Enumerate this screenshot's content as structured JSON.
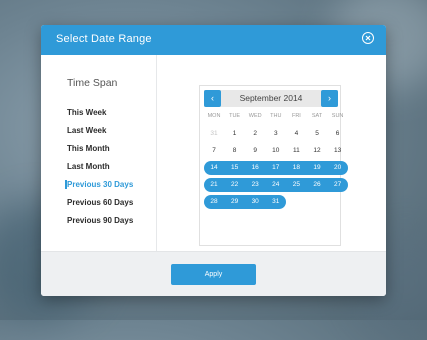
{
  "dialog": {
    "title": "Select Date Range",
    "close_icon": "close-circle-icon",
    "accent_color": "#2f9ad8"
  },
  "timespan": {
    "heading": "Time Span",
    "items": [
      {
        "label": "This Week",
        "active": false
      },
      {
        "label": "Last Week",
        "active": false
      },
      {
        "label": "This Month",
        "active": false
      },
      {
        "label": "Last Month",
        "active": false
      },
      {
        "label": "Previous 30 Days",
        "active": true
      },
      {
        "label": "Previous 60 Days",
        "active": false
      },
      {
        "label": "Previous 90 Days",
        "active": false
      }
    ]
  },
  "calendar": {
    "month_label": "September 2014",
    "prev_icon": "chevron-left-icon",
    "prev_glyph": "‹",
    "next_icon": "chevron-right-icon",
    "next_glyph": "›",
    "weekdays": [
      "MON",
      "TUE",
      "WED",
      "THU",
      "FRI",
      "SAT",
      "SUN"
    ],
    "weeks": [
      [
        {
          "d": "31",
          "muted": true
        },
        {
          "d": "1"
        },
        {
          "d": "2"
        },
        {
          "d": "3"
        },
        {
          "d": "4"
        },
        {
          "d": "5"
        },
        {
          "d": "6"
        }
      ],
      [
        {
          "d": "7"
        },
        {
          "d": "8"
        },
        {
          "d": "9"
        },
        {
          "d": "10"
        },
        {
          "d": "11"
        },
        {
          "d": "12"
        },
        {
          "d": "13"
        }
      ],
      [
        {
          "d": "14",
          "sel": true
        },
        {
          "d": "15",
          "sel": true
        },
        {
          "d": "16",
          "sel": true
        },
        {
          "d": "17",
          "sel": true
        },
        {
          "d": "18",
          "sel": true
        },
        {
          "d": "19",
          "sel": true
        },
        {
          "d": "20",
          "sel": true
        }
      ],
      [
        {
          "d": "21",
          "sel": true
        },
        {
          "d": "22",
          "sel": true
        },
        {
          "d": "23",
          "sel": true
        },
        {
          "d": "24",
          "sel": true
        },
        {
          "d": "25",
          "sel": true
        },
        {
          "d": "26",
          "sel": true
        },
        {
          "d": "27",
          "sel": true
        }
      ],
      [
        {
          "d": "28",
          "sel": true
        },
        {
          "d": "29",
          "sel": true
        },
        {
          "d": "30",
          "sel": true
        },
        {
          "d": "31",
          "sel": true
        }
      ]
    ]
  },
  "footer": {
    "apply_label": "Apply"
  }
}
